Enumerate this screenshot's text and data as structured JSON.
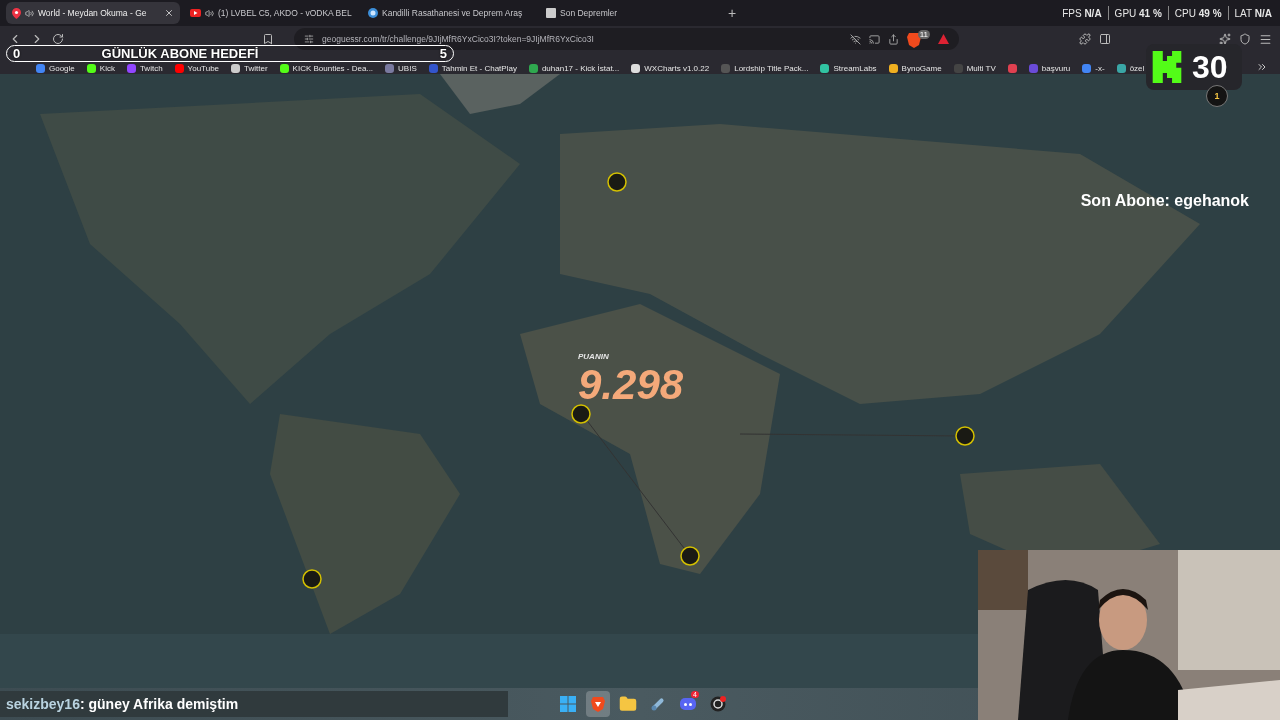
{
  "browser": {
    "tabs": [
      {
        "kind": "pin",
        "title": "World - Meydan Okuma - Ge",
        "audio": true,
        "selected": true
      },
      {
        "kind": "video",
        "title": "(1) LVBEL C5, AKDO - vODKA BEL",
        "audio": true,
        "selected": false
      },
      {
        "kind": "globe",
        "title": "Kandilli Rasathanesi ve Deprem Araş",
        "audio": false,
        "selected": false
      },
      {
        "kind": "page",
        "title": "Son Depremler",
        "audio": false,
        "selected": false
      }
    ],
    "new_tab": "+",
    "address": "geoguessr.com/tr/challenge/9JIjMfR6YxCico3I?token=9JIjMfR6YxCico3I",
    "shield_badge": "11",
    "bookmarks": [
      {
        "label": "Google",
        "color": "#4285f4"
      },
      {
        "label": "Kick",
        "color": "#53fc18"
      },
      {
        "label": "Twitch",
        "color": "#9146ff"
      },
      {
        "label": "YouTube",
        "color": "#ff0000"
      },
      {
        "label": "Twitter",
        "color": "#cccccc"
      },
      {
        "label": "KICK Bounties - Dea...",
        "color": "#53fc18"
      },
      {
        "label": "UBIS",
        "color": "#7a7aa0"
      },
      {
        "label": "Tahmin Et - ChatPlay",
        "color": "#3355cc"
      },
      {
        "label": "duhan17 - Kick İstat...",
        "color": "#2fa84f"
      },
      {
        "label": "WXCharts v1.0.22",
        "color": "#dddddd"
      },
      {
        "label": "Lordship Title Pack...",
        "color": "#555555"
      },
      {
        "label": "StreamLabs",
        "color": "#31c3a2"
      },
      {
        "label": "BynoGame",
        "color": "#f0b020"
      },
      {
        "label": "Multi TV",
        "color": "#444444"
      },
      {
        "color": "#e04050"
      },
      {
        "label": "başvuru",
        "color": "#6a4bd8"
      },
      {
        "label": "-x-",
        "color": "#4285f4"
      },
      {
        "label": "özel",
        "color": "#3aa6a6"
      }
    ]
  },
  "performance": [
    {
      "label": "FPS",
      "value": "N/A"
    },
    {
      "label": "GPU",
      "value": "41 %"
    },
    {
      "label": "CPU",
      "value": "49 %"
    },
    {
      "label": "LAT",
      "value": "N/A"
    }
  ],
  "stream_overlay": {
    "goal": {
      "current": "0",
      "title": "GÜNLÜK ABONE HEDEFİ",
      "target": "5"
    },
    "kick_count": "30",
    "notification_count": "1",
    "last_subscriber": "Son Abone: egehanok"
  },
  "score": {
    "label": "PUANIN",
    "value": "9.298"
  },
  "chat": {
    "user": "sekizbey16",
    "message": " : güney Afrika demiştim"
  },
  "taskbar": [
    {
      "kind": "windows",
      "selected": false
    },
    {
      "kind": "brave",
      "selected": true
    },
    {
      "kind": "folder",
      "selected": false
    },
    {
      "kind": "tool",
      "selected": false
    },
    {
      "kind": "discord",
      "selected": false,
      "badge": "4"
    },
    {
      "kind": "obs",
      "selected": false
    }
  ]
}
